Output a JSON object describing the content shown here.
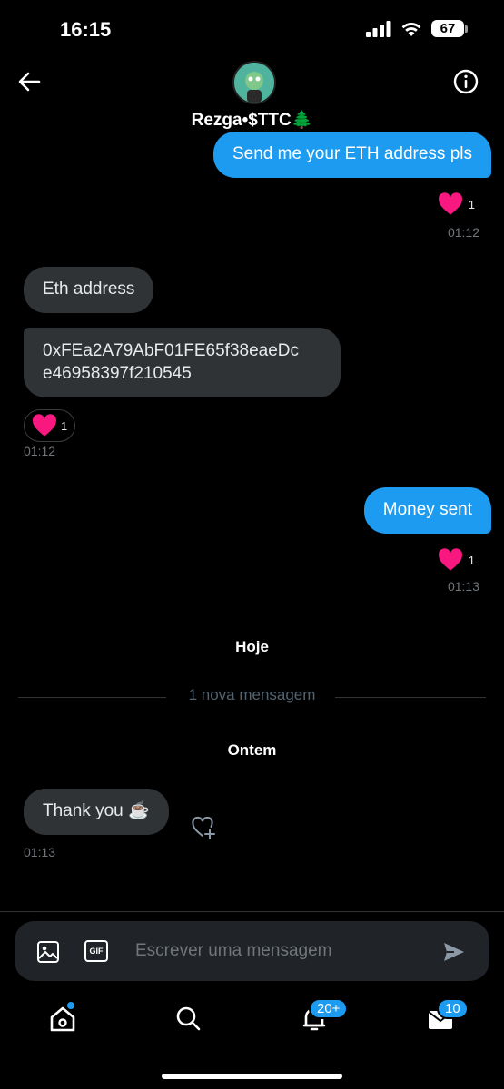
{
  "status_bar": {
    "time": "16:15",
    "battery": "67"
  },
  "header": {
    "name": "Rezga•$TTC🌲"
  },
  "messages": {
    "m1": {
      "text": "Send me your ETH address pls",
      "reaction_count": "1",
      "time": "01:12"
    },
    "m2": {
      "text": "Eth address"
    },
    "m3": {
      "line1": "0xFEa2A79AbF01FE65f38eaeDc",
      "line2": "e46958397f210545",
      "reaction_count": "1",
      "time": "01:12"
    },
    "m4": {
      "text": "Money sent",
      "reaction_count": "1",
      "time": "01:13"
    },
    "m5": {
      "text": "Thank you ☕",
      "time": "01:13"
    }
  },
  "separators": {
    "today": "Hoje",
    "new_messages": "1 nova mensagem",
    "yesterday": "Ontem"
  },
  "composer": {
    "placeholder": "Escrever uma mensagem",
    "gif_label": "GIF"
  },
  "tabbar": {
    "notifications_badge": "20+",
    "messages_badge": "10"
  },
  "colors": {
    "accent": "#1d9bf0",
    "received_bubble": "#2f3336",
    "heart": "#f91880",
    "background": "#000000"
  }
}
